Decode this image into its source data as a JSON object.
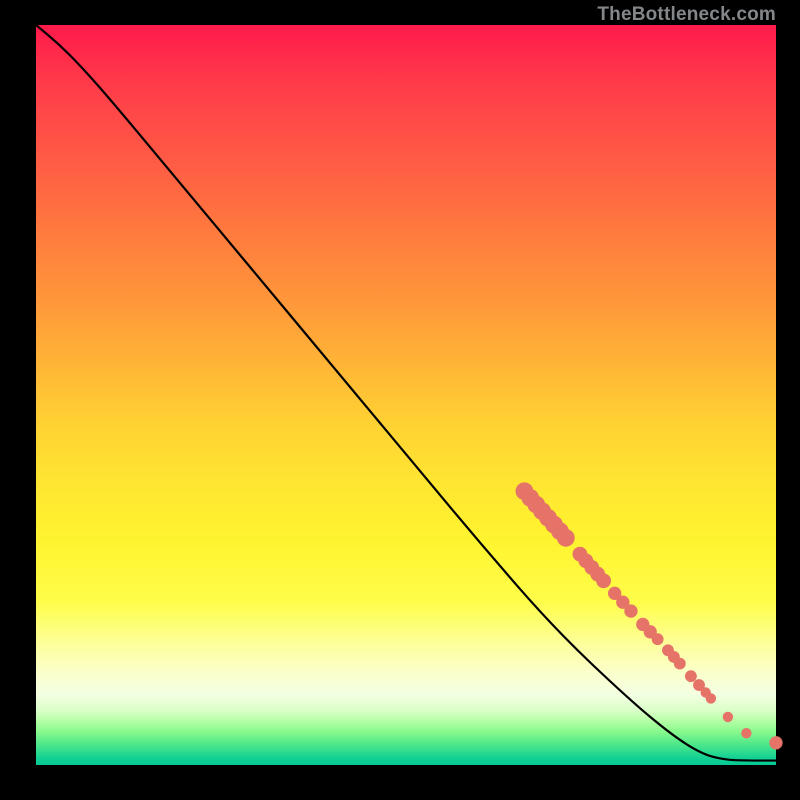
{
  "attribution": "TheBottleneck.com",
  "colors": {
    "line": "#000000",
    "marker_fill": "#e57368",
    "marker_stroke": "#a94d45",
    "background_black": "#000000"
  },
  "chart_data": {
    "type": "line",
    "title": "",
    "xlabel": "",
    "ylabel": "",
    "xlim": [
      0,
      100
    ],
    "ylim": [
      0,
      100
    ],
    "line_points": [
      {
        "x": 0,
        "y": 100
      },
      {
        "x": 3,
        "y": 97.5
      },
      {
        "x": 6,
        "y": 94.5
      },
      {
        "x": 10,
        "y": 90
      },
      {
        "x": 20,
        "y": 78
      },
      {
        "x": 30,
        "y": 66
      },
      {
        "x": 40,
        "y": 54
      },
      {
        "x": 50,
        "y": 42
      },
      {
        "x": 60,
        "y": 30
      },
      {
        "x": 70,
        "y": 18.5
      },
      {
        "x": 80,
        "y": 9
      },
      {
        "x": 86,
        "y": 4
      },
      {
        "x": 90,
        "y": 1.5
      },
      {
        "x": 93,
        "y": 0.7
      },
      {
        "x": 96,
        "y": 0.6
      },
      {
        "x": 100,
        "y": 0.6
      }
    ],
    "markers": [
      {
        "x": 66.0,
        "y": 37.0,
        "r": 1.2
      },
      {
        "x": 66.8,
        "y": 36.1,
        "r": 1.2
      },
      {
        "x": 67.6,
        "y": 35.2,
        "r": 1.2
      },
      {
        "x": 68.4,
        "y": 34.3,
        "r": 1.2
      },
      {
        "x": 69.2,
        "y": 33.4,
        "r": 1.2
      },
      {
        "x": 70.0,
        "y": 32.5,
        "r": 1.2
      },
      {
        "x": 70.8,
        "y": 31.6,
        "r": 1.2
      },
      {
        "x": 71.6,
        "y": 30.7,
        "r": 1.2
      },
      {
        "x": 73.5,
        "y": 28.5,
        "r": 1.0
      },
      {
        "x": 74.3,
        "y": 27.6,
        "r": 1.0
      },
      {
        "x": 75.1,
        "y": 26.7,
        "r": 1.0
      },
      {
        "x": 75.9,
        "y": 25.8,
        "r": 1.0
      },
      {
        "x": 76.7,
        "y": 24.9,
        "r": 1.0
      },
      {
        "x": 78.2,
        "y": 23.2,
        "r": 0.9
      },
      {
        "x": 79.3,
        "y": 22.0,
        "r": 0.9
      },
      {
        "x": 80.4,
        "y": 20.8,
        "r": 0.9
      },
      {
        "x": 82.0,
        "y": 19.0,
        "r": 0.9
      },
      {
        "x": 83.0,
        "y": 18.0,
        "r": 0.9
      },
      {
        "x": 84.0,
        "y": 17.0,
        "r": 0.8
      },
      {
        "x": 85.4,
        "y": 15.5,
        "r": 0.8
      },
      {
        "x": 86.2,
        "y": 14.6,
        "r": 0.8
      },
      {
        "x": 87.0,
        "y": 13.7,
        "r": 0.8
      },
      {
        "x": 88.5,
        "y": 12.0,
        "r": 0.8
      },
      {
        "x": 89.6,
        "y": 10.8,
        "r": 0.8
      },
      {
        "x": 90.5,
        "y": 9.8,
        "r": 0.7
      },
      {
        "x": 91.2,
        "y": 9.0,
        "r": 0.7
      },
      {
        "x": 93.5,
        "y": 6.5,
        "r": 0.7
      },
      {
        "x": 96.0,
        "y": 4.3,
        "r": 0.7
      },
      {
        "x": 100.0,
        "y": 3.0,
        "r": 0.9
      }
    ]
  }
}
